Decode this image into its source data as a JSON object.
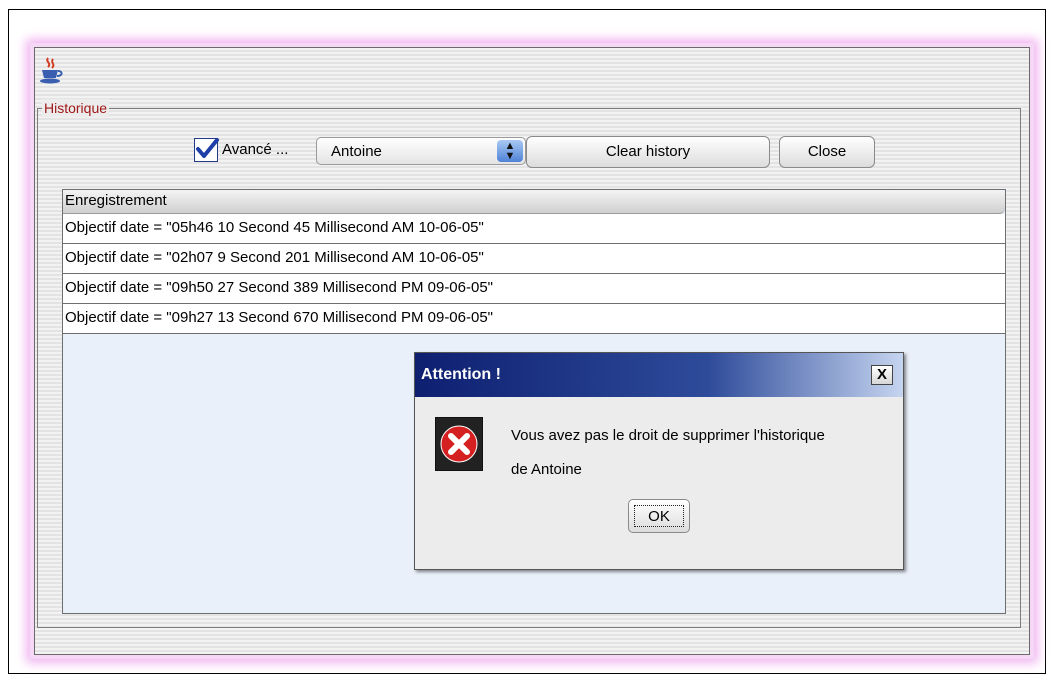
{
  "window": {
    "group_title": "Historique"
  },
  "toolbar": {
    "advanced_label": "Avancé ...",
    "advanced_checked": true,
    "user_select_value": "Antoine",
    "clear_label": "Clear history",
    "close_label": "Close"
  },
  "table": {
    "header": "Enregistrement",
    "rows": [
      "Objectif date = \"05h46 10 Second  45 Millisecond  AM 10-06-05\"",
      "Objectif date = \"02h07 9 Second  201 Millisecond  AM 10-06-05\"",
      "Objectif date = \"09h50 27 Second  389 Millisecond  PM 09-06-05\"",
      "Objectif date = \"09h27 13 Second  670 Millisecond  PM 09-06-05\""
    ]
  },
  "dialog": {
    "title": "Attention !",
    "close_symbol": "X",
    "message_line1": "Vous avez pas le droit de supprimer l'historique",
    "message_line2": "de Antoine",
    "ok_label": "OK"
  },
  "icons": {
    "app": "java-cup-icon",
    "check": "checkmark-icon",
    "combo": "spinner-arrows-icon",
    "error": "error-x-icon"
  },
  "colors": {
    "group_title": "#a01818",
    "dialog_title_start": "#0e1f70",
    "dialog_title_end": "#c5d4ef",
    "error_red": "#d42020",
    "window_glow": "#f0b4f0"
  }
}
